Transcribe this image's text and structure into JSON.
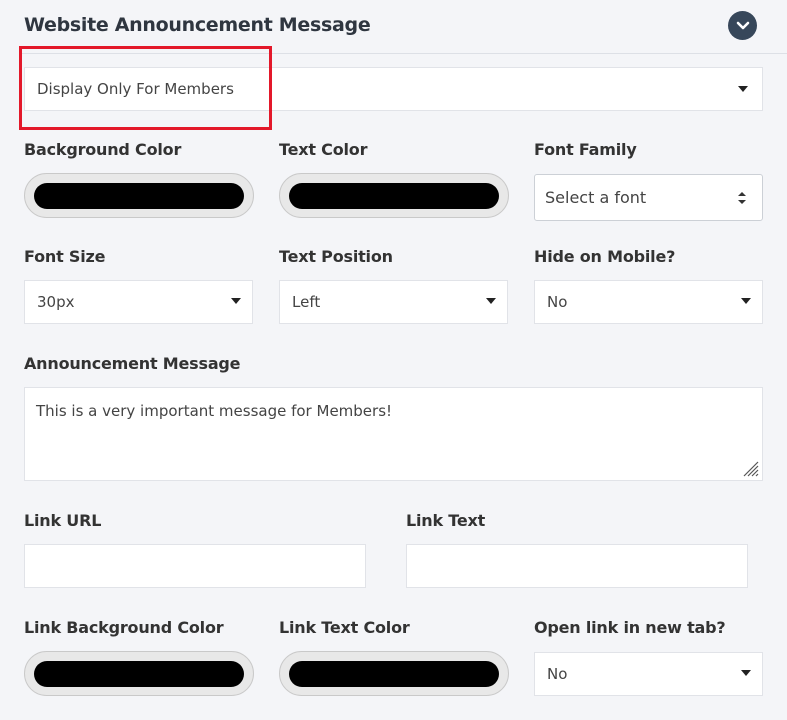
{
  "header": {
    "title": "Website Announcement Message"
  },
  "visibility_select": {
    "value": "Display Only For Members"
  },
  "labels": {
    "bg_color": "Background Color",
    "text_color": "Text Color",
    "font_family": "Font Family",
    "font_size": "Font Size",
    "text_position": "Text Position",
    "hide_mobile": "Hide on Mobile?",
    "message": "Announcement Message",
    "link_url": "Link URL",
    "link_text": "Link Text",
    "link_bg_color": "Link Background Color",
    "link_text_color": "Link Text Color",
    "open_new_tab": "Open link in new tab?"
  },
  "values": {
    "bg_color": "#000000",
    "text_color": "#000000",
    "font_family": "Select a font",
    "font_size": "30px",
    "text_position": "Left",
    "hide_mobile": "No",
    "message": "This is a very important message for Members!",
    "link_url": "",
    "link_text": "",
    "link_bg_color": "#000000",
    "link_text_color": "#000000",
    "open_new_tab": "No"
  },
  "colors": {
    "highlight": "#e3182a",
    "collapse_button": "#37475a"
  },
  "icons": {
    "collapse": "chevron-down-icon",
    "resize": "resize-grip-icon",
    "dropdown": "caret-down-icon"
  }
}
